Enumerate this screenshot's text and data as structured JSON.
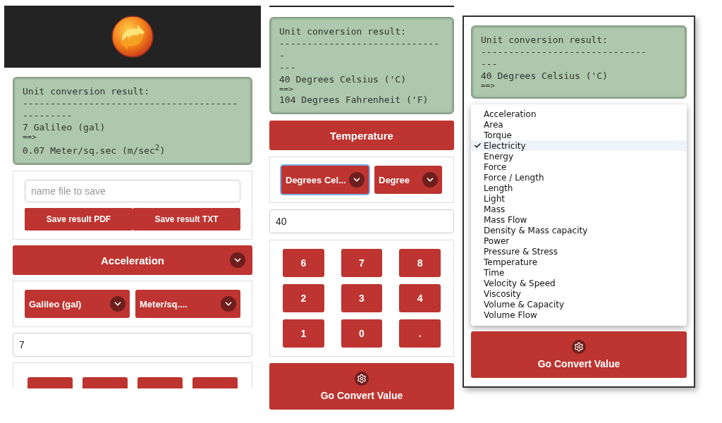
{
  "screen_1": {
    "result_lines": [
      "Unit conversion result:",
      "------------------------------------------------",
      "7 Galileo (gal)",
      "==>",
      "0.07 Meter/sq.sec (m/sec$^{2}$)"
    ],
    "save": {
      "placeholder": "name file to save",
      "buttons": [
        "Save result PDF",
        "Save result TXT"
      ]
    },
    "category": "Acceleration",
    "units": [
      {
        "label": "Galileo (gal)",
        "focused": false
      },
      {
        "label": "Meter/sq....",
        "focused": false
      }
    ],
    "value": "7"
  },
  "screen_2": {
    "result_lines": [
      "Unit conversion result:",
      "------------------------------",
      "---",
      "40 Degrees Celsius ('C)",
      "==>",
      "104 Degrees Fahrenheit ('F)"
    ],
    "category": "Temperature",
    "units": [
      {
        "label": "Degrees Cel...",
        "focused": true
      },
      {
        "label": "Degree",
        "focused": false
      }
    ],
    "value": "40",
    "keypad": [
      "6",
      "7",
      "8",
      "2",
      "3",
      "4",
      "1",
      "0",
      "."
    ],
    "convert_button": "Go Convert Value"
  },
  "screen_3": {
    "result_lines": [
      "Unit conversion result:",
      "------------------------------",
      "---",
      "40 Degrees Celsius ('C)",
      "==>"
    ],
    "category_menu": [
      {
        "label": "Acceleration",
        "selected": false
      },
      {
        "label": "Area",
        "selected": false
      },
      {
        "label": "Torque",
        "selected": false
      },
      {
        "label": "Electricity",
        "selected": true
      },
      {
        "label": "Energy",
        "selected": false
      },
      {
        "label": "Force",
        "selected": false
      },
      {
        "label": "Force / Length",
        "selected": false
      },
      {
        "label": "Length",
        "selected": false
      },
      {
        "label": "Light",
        "selected": false
      },
      {
        "label": "Mass",
        "selected": false
      },
      {
        "label": "Mass Flow",
        "selected": false
      },
      {
        "label": "Density & Mass capacity",
        "selected": false
      },
      {
        "label": "Power",
        "selected": false
      },
      {
        "label": "Pressure & Stress",
        "selected": false
      },
      {
        "label": "Temperature",
        "selected": false
      },
      {
        "label": "Time",
        "selected": false
      },
      {
        "label": "Velocity & Speed",
        "selected": false
      },
      {
        "label": "Viscosity",
        "selected": false
      },
      {
        "label": "Volume & Capacity",
        "selected": false
      },
      {
        "label": "Volume Flow",
        "selected": false
      }
    ],
    "convert_button": "Go Convert Value"
  }
}
